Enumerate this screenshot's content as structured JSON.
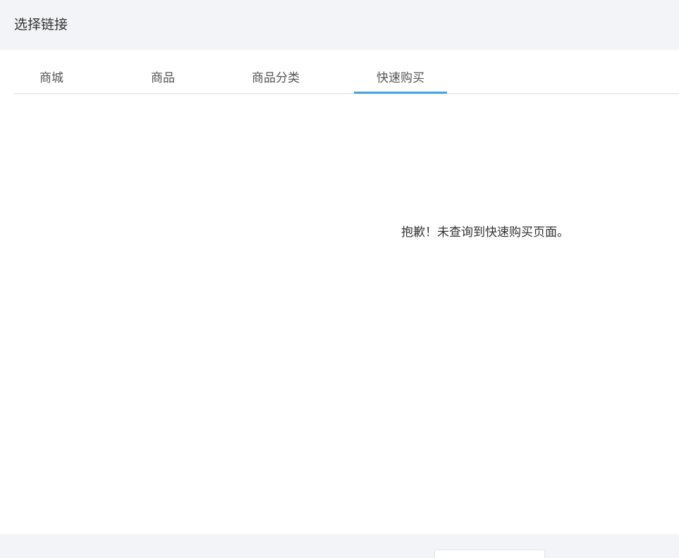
{
  "dialog": {
    "title": "选择链接"
  },
  "tabs": [
    {
      "label": "商城",
      "active": false
    },
    {
      "label": "商品",
      "active": false
    },
    {
      "label": "商品分类",
      "active": false
    },
    {
      "label": "快速购买",
      "active": true
    }
  ],
  "content": {
    "empty_message": "抱歉！未查询到快速购买页面。"
  },
  "colors": {
    "header_bg": "#f3f4f7",
    "active_tab_indicator": "#46a3e5",
    "tab_divider": "#e9ecef"
  }
}
